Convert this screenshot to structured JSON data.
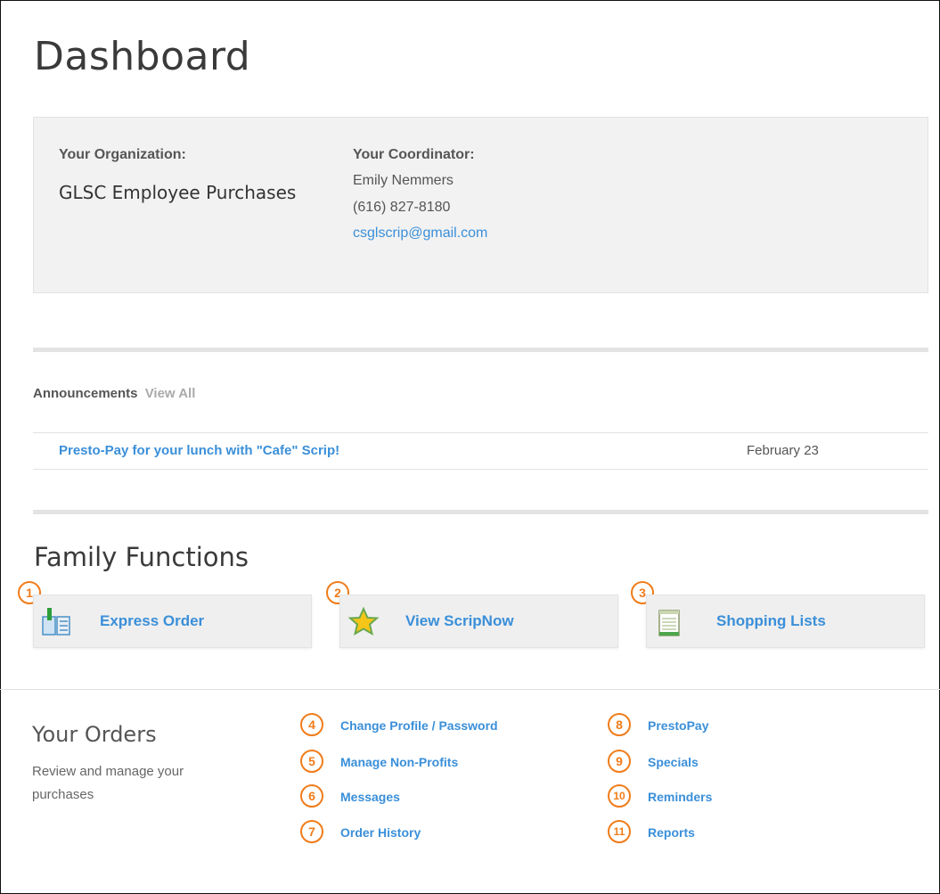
{
  "page": {
    "title": "Dashboard"
  },
  "organization": {
    "label": "Your Organization:",
    "name": "GLSC Employee Purchases",
    "coordinator_label": "Your Coordinator:",
    "coordinator_name": "Emily Nemmers",
    "coordinator_phone": "(616) 827-8180",
    "coordinator_email": "csglscrip@gmail.com"
  },
  "announcements": {
    "heading": "Announcements",
    "view_all": "View All",
    "items": [
      {
        "title": "Presto-Pay for your lunch with \"Cafe\" Scrip!",
        "date": "February 23"
      }
    ]
  },
  "family_functions": {
    "title": "Family Functions",
    "buttons": [
      {
        "number": "1",
        "label": "Express Order",
        "icon": "express-order-icon"
      },
      {
        "number": "2",
        "label": "View ScripNow",
        "icon": "star-icon"
      },
      {
        "number": "3",
        "label": "Shopping Lists",
        "icon": "notepad-icon"
      }
    ]
  },
  "orders": {
    "title": "Your Orders",
    "description": "Review and manage your purchases",
    "links_left": [
      {
        "number": "4",
        "label": "Change Profile / Password"
      },
      {
        "number": "5",
        "label": "Manage Non-Profits"
      },
      {
        "number": "6",
        "label": "Messages"
      },
      {
        "number": "7",
        "label": "Order History"
      }
    ],
    "links_right": [
      {
        "number": "8",
        "label": "PrestoPay"
      },
      {
        "number": "9",
        "label": "Specials"
      },
      {
        "number": "10",
        "label": "Reminders"
      },
      {
        "number": "11",
        "label": "Reports"
      }
    ]
  },
  "colors": {
    "link": "#3a8fd9",
    "annotation": "#f07c1a",
    "panel": "#f2f2f2"
  }
}
